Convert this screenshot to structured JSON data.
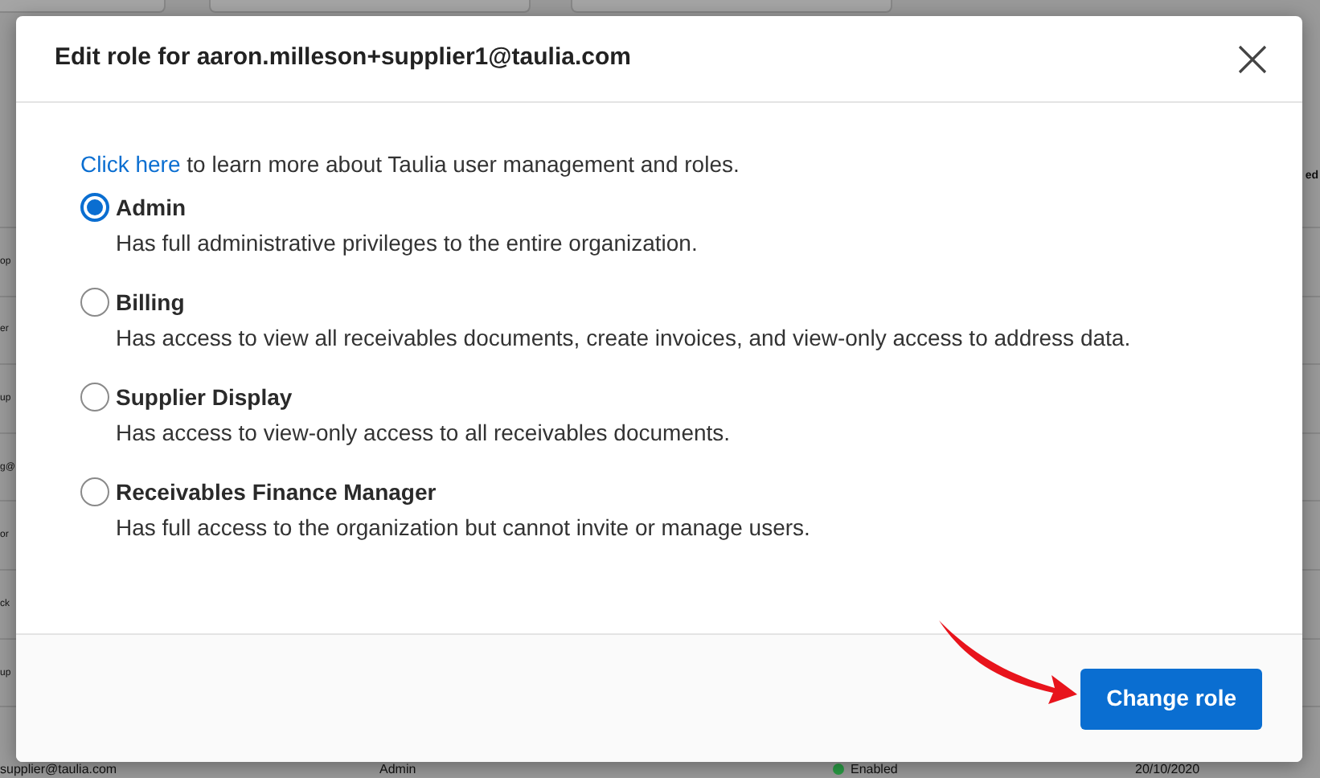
{
  "background": {
    "left_fragments": [
      "op",
      "er",
      "up",
      "g@",
      "or",
      "ck",
      "up"
    ],
    "header_fragment": "ed",
    "last_row": {
      "email": "supplier@taulia.com",
      "role": "Admin",
      "status": "Enabled",
      "date": "20/10/2020"
    }
  },
  "dialog": {
    "title": "Edit role for aaron.milleson+supplier1@taulia.com",
    "intro_link": "Click here",
    "intro_text": " to learn more about Taulia user management and roles.",
    "roles": [
      {
        "label": "Admin",
        "description": "Has full administrative privileges to the entire organization.",
        "selected": true
      },
      {
        "label": "Billing",
        "description": "Has access to view all receivables documents, create invoices, and view-only access to address data.",
        "selected": false
      },
      {
        "label": "Supplier Display",
        "description": "Has access to view-only access to all receivables documents.",
        "selected": false
      },
      {
        "label": "Receivables Finance Manager",
        "description": "Has full access to the organization but cannot invite or manage users.",
        "selected": false
      }
    ],
    "button": "Change role"
  }
}
